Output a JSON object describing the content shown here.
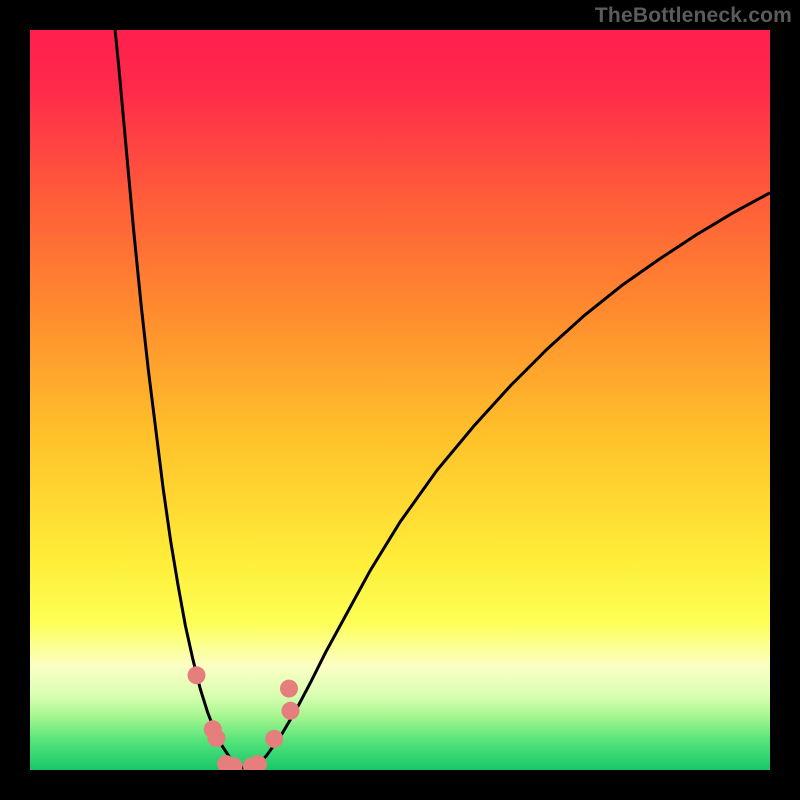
{
  "watermark": "TheBottleneck.com",
  "chart_data": {
    "type": "line",
    "title": "",
    "xlabel": "",
    "ylabel": "",
    "xlim": [
      0,
      100
    ],
    "ylim": [
      0,
      100
    ],
    "series": [
      {
        "name": "bottleneck-curve",
        "x": [
          11.5,
          12,
          13,
          14,
          15,
          16,
          17,
          18,
          19,
          20,
          21,
          22,
          23,
          24,
          25,
          26,
          27,
          28,
          29,
          30,
          31,
          32,
          34,
          36,
          38,
          40,
          43,
          46,
          50,
          55,
          60,
          65,
          70,
          75,
          80,
          85,
          90,
          95,
          100
        ],
        "y": [
          100,
          95,
          84,
          73,
          63,
          54,
          46,
          38,
          31,
          25,
          19.5,
          15,
          11,
          7.8,
          5.2,
          3.2,
          1.7,
          0.7,
          0.2,
          0.2,
          0.9,
          2,
          4.8,
          8.2,
          12,
          16,
          21.5,
          27,
          33.5,
          40.5,
          46.5,
          52,
          57,
          61.5,
          65.5,
          69,
          72.3,
          75.3,
          78
        ]
      }
    ],
    "markers": [
      {
        "x": 22.5,
        "y": 12.8
      },
      {
        "x": 24.7,
        "y": 5.5
      },
      {
        "x": 25.2,
        "y": 4.3
      },
      {
        "x": 26.5,
        "y": 0.8
      },
      {
        "x": 27.5,
        "y": 0.5
      },
      {
        "x": 30.0,
        "y": 0.5
      },
      {
        "x": 30.8,
        "y": 0.8
      },
      {
        "x": 33.0,
        "y": 4.2
      },
      {
        "x": 35.2,
        "y": 8.0
      },
      {
        "x": 35.0,
        "y": 11.0
      }
    ],
    "gradient_stops": [
      {
        "offset": 0,
        "color": "#ff1f4f"
      },
      {
        "offset": 0.08,
        "color": "#ff2a4a"
      },
      {
        "offset": 0.22,
        "color": "#ff5a3a"
      },
      {
        "offset": 0.38,
        "color": "#ff8b2e"
      },
      {
        "offset": 0.55,
        "color": "#ffc22a"
      },
      {
        "offset": 0.72,
        "color": "#ffee3a"
      },
      {
        "offset": 0.8,
        "color": "#fdff55"
      },
      {
        "offset": 0.86,
        "color": "#fbffc5"
      },
      {
        "offset": 0.9,
        "color": "#d8ffb0"
      },
      {
        "offset": 0.93,
        "color": "#a0f58d"
      },
      {
        "offset": 0.96,
        "color": "#55e47a"
      },
      {
        "offset": 1.0,
        "color": "#18c76a"
      }
    ],
    "marker_color": "#e67e7e",
    "curve_color": "#000000"
  },
  "plot_geometry": {
    "inner_left": 30,
    "inner_top": 30,
    "inner_width": 740,
    "inner_height": 740
  }
}
